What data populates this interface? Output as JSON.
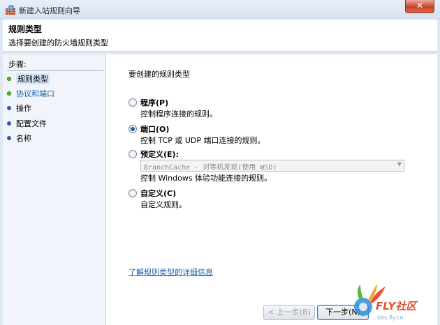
{
  "window": {
    "title": "新建入站规则向导",
    "close_label": "✕"
  },
  "header": {
    "title": "规则类型",
    "subtitle": "选择要创建的防火墙规则类型"
  },
  "steps": {
    "heading": "步骤:",
    "items": [
      {
        "label": "规则类型",
        "state": "current"
      },
      {
        "label": "协议和端口",
        "state": "link"
      },
      {
        "label": "操作",
        "state": "pending"
      },
      {
        "label": "配置文件",
        "state": "pending"
      },
      {
        "label": "名称",
        "state": "pending"
      }
    ]
  },
  "main": {
    "question": "要创建的规则类型",
    "options": [
      {
        "label": "程序(P)",
        "desc": "控制程序连接的规则。",
        "selected": false
      },
      {
        "label": "端口(O)",
        "desc": "控制 TCP 或 UDP 端口连接的规则。",
        "selected": true
      },
      {
        "label": "预定义(E):",
        "desc": "控制 Windows 体验功能连接的规则。",
        "selected": false
      },
      {
        "label": "自定义(C)",
        "desc": "自定义规则。",
        "selected": false
      }
    ],
    "predefined_value": "BranchCache - 对等机发现(使用 WSD)",
    "learn_more": "了解规则类型的详细信息"
  },
  "buttons": {
    "back": "< 上一步(B)",
    "next": "下一步(N)"
  },
  "watermark": {
    "text": "FLY社区",
    "url": "bbs.fly.cn"
  },
  "colors": {
    "accent": "#1c5ea8",
    "step_done": "#4cba2d",
    "step_pending": "#3f4fb3",
    "close": "#c7432b"
  }
}
